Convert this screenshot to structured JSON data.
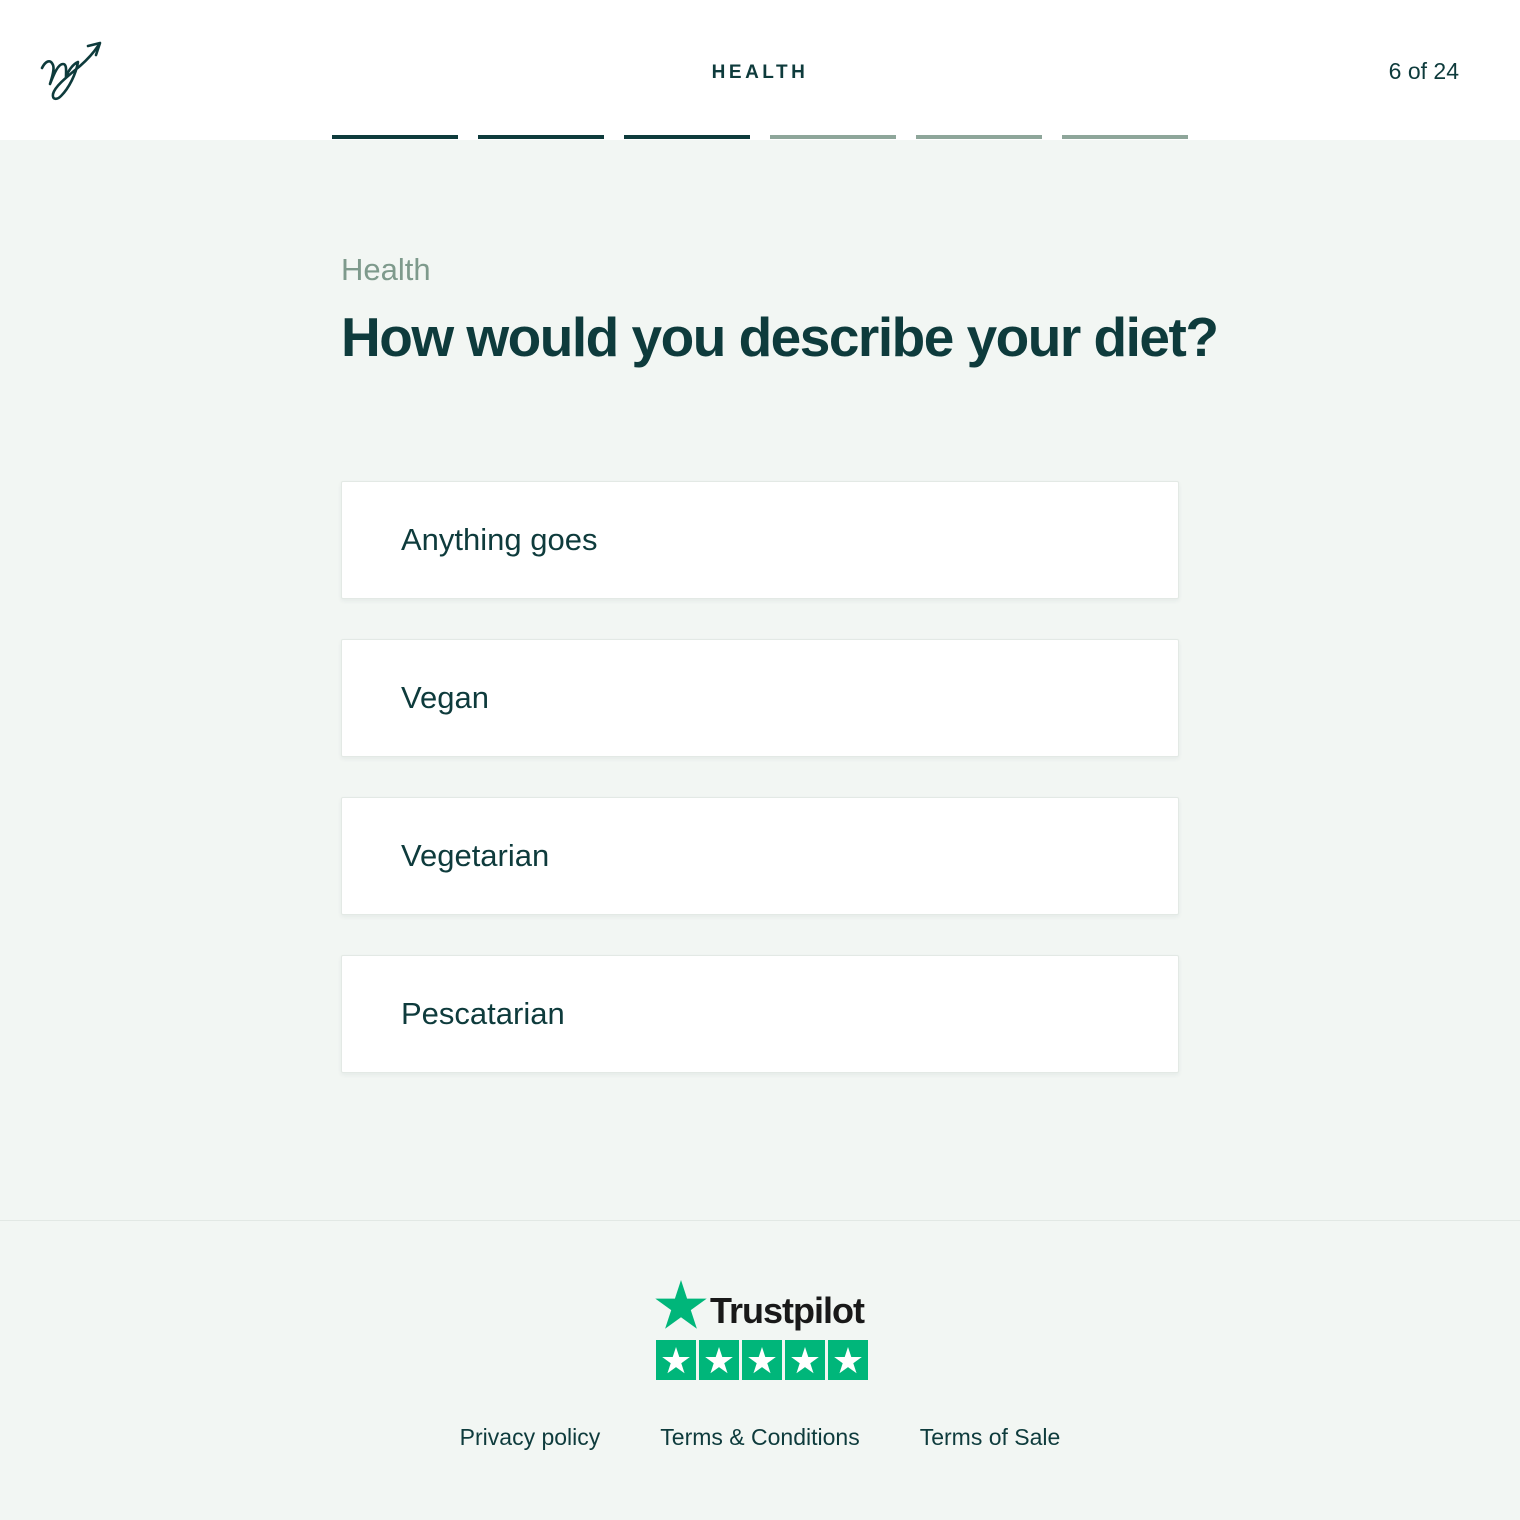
{
  "header": {
    "section_title": "HEALTH",
    "step_counter": "6 of 24"
  },
  "progress": {
    "total_segments": 6,
    "completed_segments": 3
  },
  "question": {
    "eyebrow": "Health",
    "title": "How would you describe your diet?"
  },
  "options": [
    {
      "label": "Anything goes"
    },
    {
      "label": "Vegan"
    },
    {
      "label": "Vegetarian"
    },
    {
      "label": "Pescatarian"
    }
  ],
  "trustpilot": {
    "wordmark": "Trustpilot",
    "rating_stars": 5
  },
  "footer": {
    "links": [
      {
        "label": "Privacy policy"
      },
      {
        "label": "Terms & Conditions"
      },
      {
        "label": "Terms of Sale"
      }
    ]
  },
  "colors": {
    "brand_dark": "#0e3b3c",
    "progress_inactive": "#8ea69a",
    "eyebrow": "#7e9a8c",
    "background": "#f2f6f3",
    "trustpilot_green": "#00b67a"
  },
  "icons": {
    "logo": "brand-logo-icon",
    "trustpilot_star": "star-icon"
  }
}
